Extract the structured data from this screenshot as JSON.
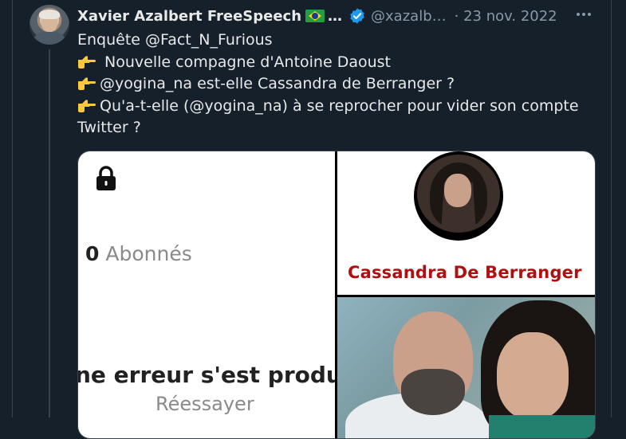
{
  "author": {
    "name": "Xavier Azalbert FreeSpeech",
    "name_suffix": "…",
    "handle": "@xazalb…",
    "date": "· 23 nov. 2022",
    "flag_icon": "brazil-flag-icon",
    "verified_color": "#1d9bf0"
  },
  "tweet": {
    "lines": [
      "Enquête @Fact_N_Furious",
      " Nouvelle compagne d'Antoine Daoust",
      "@yogina_na est-elle Cassandra de Berranger ?",
      "Qu'a-t-elle (@yogina_na) à se reprocher pour vider son compte",
      "Twitter ?"
    ],
    "pointing_icon": "pointing-hand-icon"
  },
  "media": {
    "left": {
      "count": "0",
      "followers_label": "Abonnés",
      "error_text": "ne erreur s'est produit",
      "retry_label": "Réessayer"
    },
    "top_right": {
      "profile_name": "Cassandra De Berranger",
      "name_color": "#b01010"
    }
  },
  "theme": {
    "background": "#15202b",
    "text": "#e7e9ea",
    "muted": "#8b98a5"
  }
}
